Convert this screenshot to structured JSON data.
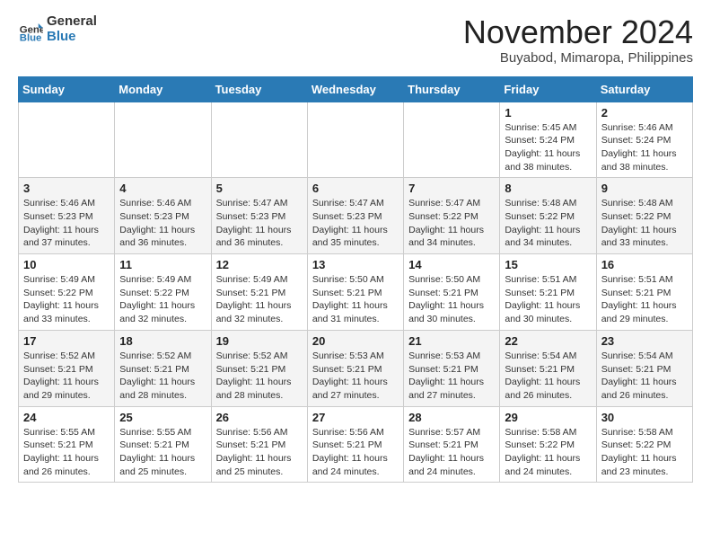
{
  "header": {
    "logo_general": "General",
    "logo_blue": "Blue",
    "month_title": "November 2024",
    "subtitle": "Buyabod, Mimaropa, Philippines"
  },
  "weekdays": [
    "Sunday",
    "Monday",
    "Tuesday",
    "Wednesday",
    "Thursday",
    "Friday",
    "Saturday"
  ],
  "weeks": [
    [
      {
        "day": "",
        "info": ""
      },
      {
        "day": "",
        "info": ""
      },
      {
        "day": "",
        "info": ""
      },
      {
        "day": "",
        "info": ""
      },
      {
        "day": "",
        "info": ""
      },
      {
        "day": "1",
        "info": "Sunrise: 5:45 AM\nSunset: 5:24 PM\nDaylight: 11 hours and 38 minutes."
      },
      {
        "day": "2",
        "info": "Sunrise: 5:46 AM\nSunset: 5:24 PM\nDaylight: 11 hours and 38 minutes."
      }
    ],
    [
      {
        "day": "3",
        "info": "Sunrise: 5:46 AM\nSunset: 5:23 PM\nDaylight: 11 hours and 37 minutes."
      },
      {
        "day": "4",
        "info": "Sunrise: 5:46 AM\nSunset: 5:23 PM\nDaylight: 11 hours and 36 minutes."
      },
      {
        "day": "5",
        "info": "Sunrise: 5:47 AM\nSunset: 5:23 PM\nDaylight: 11 hours and 36 minutes."
      },
      {
        "day": "6",
        "info": "Sunrise: 5:47 AM\nSunset: 5:23 PM\nDaylight: 11 hours and 35 minutes."
      },
      {
        "day": "7",
        "info": "Sunrise: 5:47 AM\nSunset: 5:22 PM\nDaylight: 11 hours and 34 minutes."
      },
      {
        "day": "8",
        "info": "Sunrise: 5:48 AM\nSunset: 5:22 PM\nDaylight: 11 hours and 34 minutes."
      },
      {
        "day": "9",
        "info": "Sunrise: 5:48 AM\nSunset: 5:22 PM\nDaylight: 11 hours and 33 minutes."
      }
    ],
    [
      {
        "day": "10",
        "info": "Sunrise: 5:49 AM\nSunset: 5:22 PM\nDaylight: 11 hours and 33 minutes."
      },
      {
        "day": "11",
        "info": "Sunrise: 5:49 AM\nSunset: 5:22 PM\nDaylight: 11 hours and 32 minutes."
      },
      {
        "day": "12",
        "info": "Sunrise: 5:49 AM\nSunset: 5:21 PM\nDaylight: 11 hours and 32 minutes."
      },
      {
        "day": "13",
        "info": "Sunrise: 5:50 AM\nSunset: 5:21 PM\nDaylight: 11 hours and 31 minutes."
      },
      {
        "day": "14",
        "info": "Sunrise: 5:50 AM\nSunset: 5:21 PM\nDaylight: 11 hours and 30 minutes."
      },
      {
        "day": "15",
        "info": "Sunrise: 5:51 AM\nSunset: 5:21 PM\nDaylight: 11 hours and 30 minutes."
      },
      {
        "day": "16",
        "info": "Sunrise: 5:51 AM\nSunset: 5:21 PM\nDaylight: 11 hours and 29 minutes."
      }
    ],
    [
      {
        "day": "17",
        "info": "Sunrise: 5:52 AM\nSunset: 5:21 PM\nDaylight: 11 hours and 29 minutes."
      },
      {
        "day": "18",
        "info": "Sunrise: 5:52 AM\nSunset: 5:21 PM\nDaylight: 11 hours and 28 minutes."
      },
      {
        "day": "19",
        "info": "Sunrise: 5:52 AM\nSunset: 5:21 PM\nDaylight: 11 hours and 28 minutes."
      },
      {
        "day": "20",
        "info": "Sunrise: 5:53 AM\nSunset: 5:21 PM\nDaylight: 11 hours and 27 minutes."
      },
      {
        "day": "21",
        "info": "Sunrise: 5:53 AM\nSunset: 5:21 PM\nDaylight: 11 hours and 27 minutes."
      },
      {
        "day": "22",
        "info": "Sunrise: 5:54 AM\nSunset: 5:21 PM\nDaylight: 11 hours and 26 minutes."
      },
      {
        "day": "23",
        "info": "Sunrise: 5:54 AM\nSunset: 5:21 PM\nDaylight: 11 hours and 26 minutes."
      }
    ],
    [
      {
        "day": "24",
        "info": "Sunrise: 5:55 AM\nSunset: 5:21 PM\nDaylight: 11 hours and 26 minutes."
      },
      {
        "day": "25",
        "info": "Sunrise: 5:55 AM\nSunset: 5:21 PM\nDaylight: 11 hours and 25 minutes."
      },
      {
        "day": "26",
        "info": "Sunrise: 5:56 AM\nSunset: 5:21 PM\nDaylight: 11 hours and 25 minutes."
      },
      {
        "day": "27",
        "info": "Sunrise: 5:56 AM\nSunset: 5:21 PM\nDaylight: 11 hours and 24 minutes."
      },
      {
        "day": "28",
        "info": "Sunrise: 5:57 AM\nSunset: 5:21 PM\nDaylight: 11 hours and 24 minutes."
      },
      {
        "day": "29",
        "info": "Sunrise: 5:58 AM\nSunset: 5:22 PM\nDaylight: 11 hours and 24 minutes."
      },
      {
        "day": "30",
        "info": "Sunrise: 5:58 AM\nSunset: 5:22 PM\nDaylight: 11 hours and 23 minutes."
      }
    ]
  ]
}
